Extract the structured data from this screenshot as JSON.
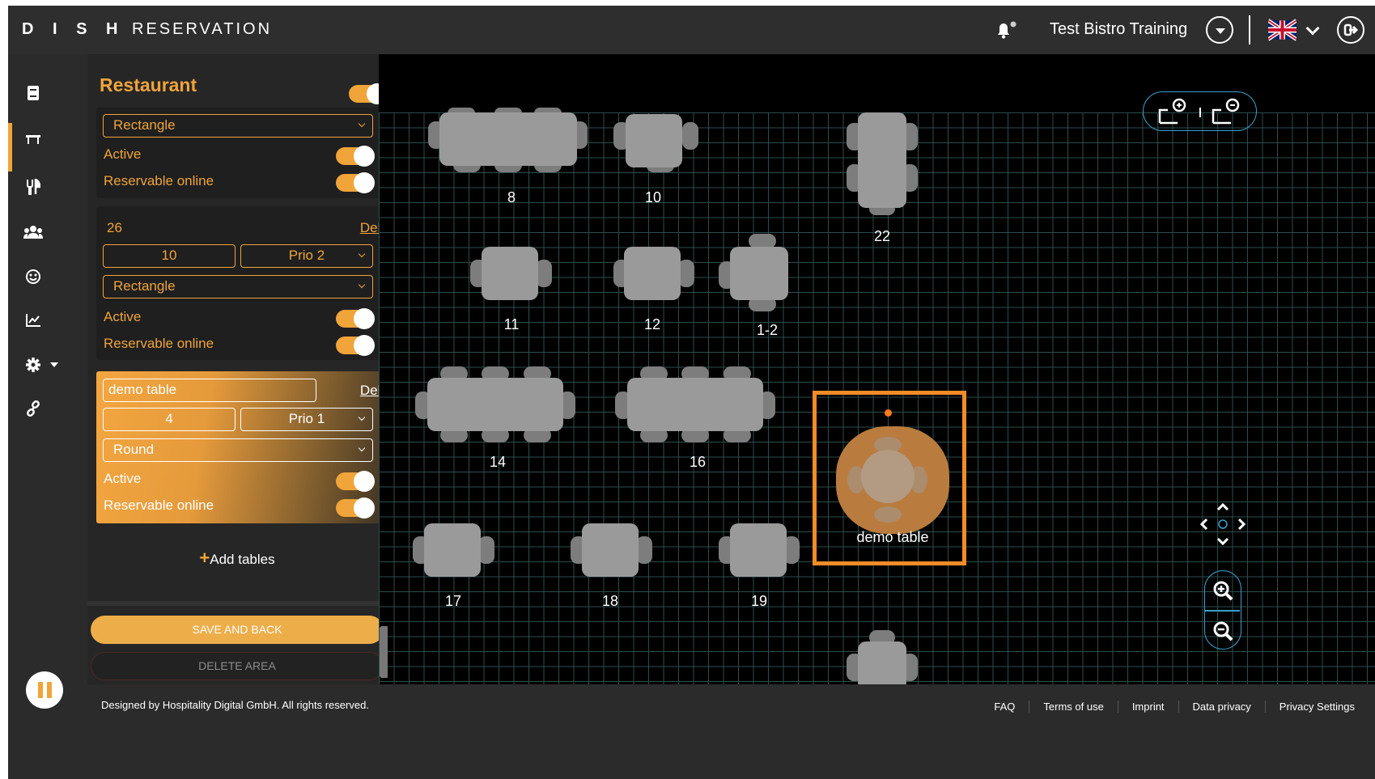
{
  "header": {
    "brand_bold": "D I S H",
    "brand_light": "RESERVATION",
    "venue_name": "Test Bistro Training"
  },
  "nav": {
    "items": [
      "book-icon",
      "table-icon",
      "cutlery-icon",
      "guests-icon",
      "smile-icon",
      "chart-icon",
      "settings-icon",
      "link-icon"
    ],
    "active_index": 1
  },
  "panel": {
    "title": "Restaurant",
    "title_toggle_on": true,
    "card1": {
      "shape": "Rectangle",
      "active_label": "Active",
      "online_label": "Reservable online"
    },
    "card2": {
      "number": "26",
      "delete_label": "Delete",
      "seats": "10",
      "priority": "Prio 2",
      "shape": "Rectangle",
      "active_label": "Active",
      "online_label": "Reservable online"
    },
    "card3": {
      "name": "demo table",
      "delete_label": "Delete",
      "seats": "4",
      "priority": "Prio 1",
      "shape": "Round",
      "active_label": "Active",
      "online_label": "Reservable online"
    },
    "add_tables_label": "Add tables",
    "save_label": "SAVE AND BACK",
    "delete_area_label": "DELETE AREA"
  },
  "canvas": {
    "tables": [
      "8",
      "10",
      "22",
      "11",
      "12",
      "1-2",
      "14",
      "16",
      "17",
      "18",
      "19"
    ],
    "selected_table_label": "demo table"
  },
  "footer": {
    "copyright": "Designed by Hospitality Digital GmbH. All rights reserved.",
    "links": [
      "FAQ",
      "Terms of use",
      "Imprint",
      "Data privacy",
      "Privacy Settings"
    ]
  },
  "colors": {
    "accent": "#f0a43a",
    "selection": "#f28c28",
    "grid": "#2c4d4a",
    "control_outline": "#3aa0c8"
  }
}
